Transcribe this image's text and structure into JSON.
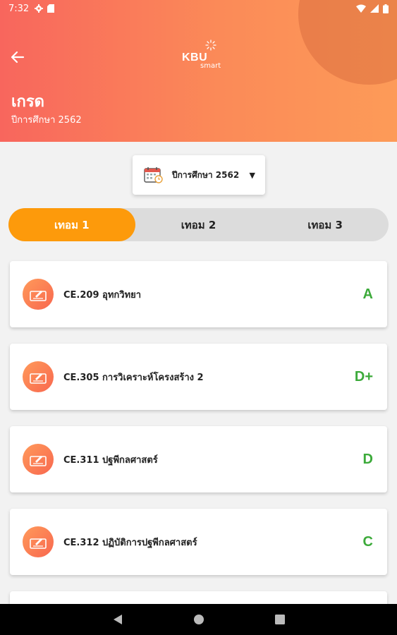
{
  "status_bar": {
    "time": "7:32",
    "icons": [
      "gear-icon",
      "sd-card-icon",
      "wifi-icon",
      "signal-icon",
      "battery-icon"
    ]
  },
  "header": {
    "logo_text": "KBU",
    "logo_sub": "smart",
    "title": "เกรด",
    "subtitle": "ปีการศึกษา 2562",
    "colors": {
      "gradient_start": "#f8665d",
      "gradient_end": "#fd9b58"
    }
  },
  "year_selector": {
    "label": "ปีการศึกษา 2562",
    "icon": "calendar-icon"
  },
  "tabs": [
    {
      "label": "เทอม 1",
      "active": true
    },
    {
      "label": "เทอม 2",
      "active": false
    },
    {
      "label": "เทอม 3",
      "active": false
    }
  ],
  "courses": [
    {
      "name": "CE.209 อุทกวิทยา",
      "grade": "A"
    },
    {
      "name": "CE.305 การวิเคราะห์โครงสร้าง 2",
      "grade": "D+"
    },
    {
      "name": "CE.311 ปฐพีกลศาสตร์",
      "grade": "D"
    },
    {
      "name": "CE.312 ปฏิบัติการปฐพีกลศาสตร์",
      "grade": "C"
    }
  ],
  "colors": {
    "accent": "#fd9a0b",
    "grade": "#3caa3a",
    "tab_bg": "#dcdcdc"
  },
  "nav": [
    "back-triangle-icon",
    "home-circle-icon",
    "recents-square-icon"
  ]
}
